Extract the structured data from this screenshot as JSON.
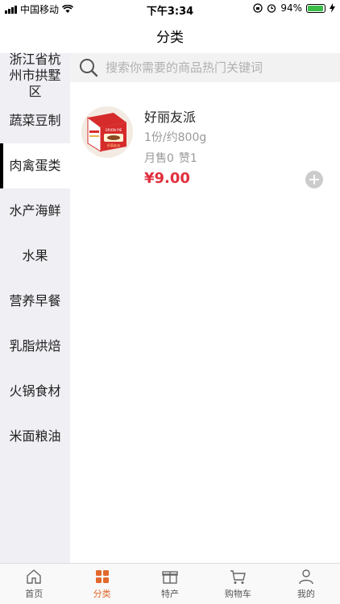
{
  "status": {
    "carrier": "中国移动",
    "time": "下午3:34",
    "battery_pct": "94%",
    "battery_level": 0.94
  },
  "header": {
    "title": "分类"
  },
  "search": {
    "placeholder": "搜索你需要的商品热门关键词"
  },
  "sidebar": {
    "items": [
      {
        "label": "浙江省杭州市拱墅区"
      },
      {
        "label": "蔬菜豆制"
      },
      {
        "label": "肉禽蛋类"
      },
      {
        "label": "水产海鲜"
      },
      {
        "label": "水果"
      },
      {
        "label": "营养早餐"
      },
      {
        "label": "乳脂烘焙"
      },
      {
        "label": "火锅食材"
      },
      {
        "label": "米面粮油"
      }
    ],
    "active_index": 2
  },
  "product": {
    "name": "好丽友派",
    "spec": "1份/约800g",
    "sold": "月售0",
    "likes": "赞1",
    "price": "¥9.00",
    "image_text": "ORION PIE",
    "image_cn": "好丽友派"
  },
  "tabs": [
    {
      "label": "首页",
      "icon": "home-icon"
    },
    {
      "label": "分类",
      "icon": "category-icon"
    },
    {
      "label": "特产",
      "icon": "gift-icon"
    },
    {
      "label": "购物车",
      "icon": "cart-icon"
    },
    {
      "label": "我的",
      "icon": "user-icon"
    }
  ],
  "colors": {
    "accent": "#e2682b",
    "price": "#e0303f",
    "sidebar_bg": "#efeff4"
  }
}
